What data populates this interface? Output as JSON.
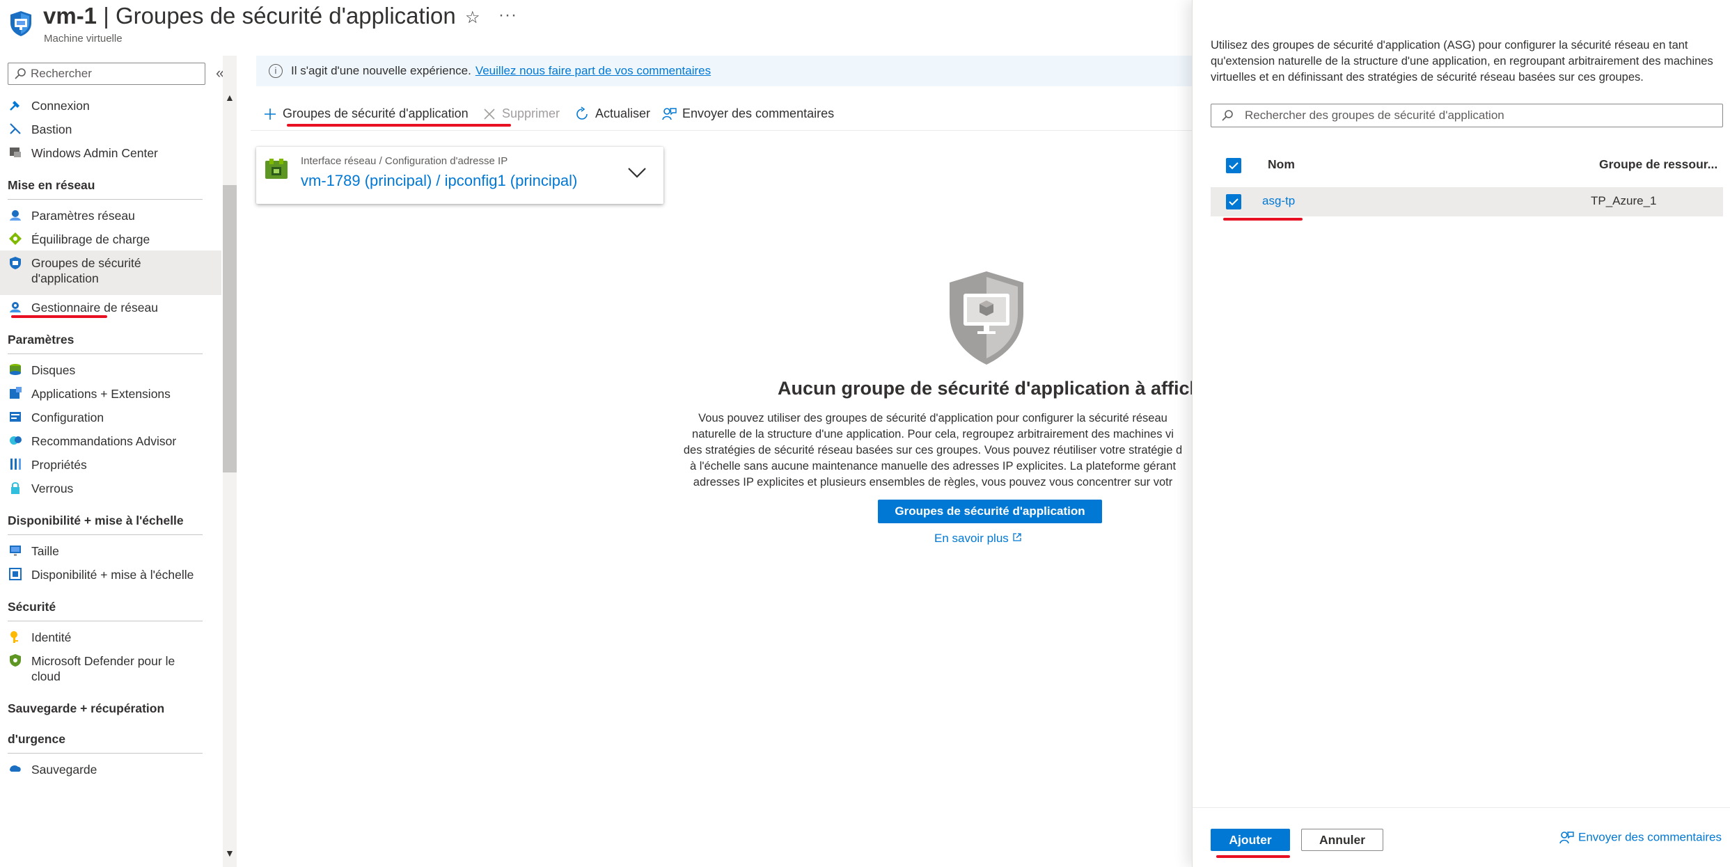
{
  "header": {
    "resource_name": "vm-1",
    "separator": " | ",
    "blade_title": "Groupes de sécurité d'application",
    "subtitle": "Machine virtuelle",
    "favorite_icon": "star-icon",
    "more_icon": "ellipsis-icon"
  },
  "sidebar": {
    "search_placeholder": "Rechercher",
    "collapse_glyph": "«",
    "items": [
      {
        "label": "Connexion",
        "icon": "connect-icon"
      },
      {
        "label": "Bastion",
        "icon": "bastion-icon"
      },
      {
        "label": "Windows Admin Center",
        "icon": "windows-admin-center-icon"
      },
      {
        "section": "Mise en réseau"
      },
      {
        "label": "Paramètres réseau",
        "icon": "network-settings-icon"
      },
      {
        "label": "Équilibrage de charge",
        "icon": "load-balancing-icon"
      },
      {
        "label": "Groupes de sécurité d'application",
        "icon": "asg-shield-icon",
        "selected": true
      },
      {
        "label": "Gestionnaire de réseau",
        "icon": "network-manager-icon"
      },
      {
        "section": "Paramètres"
      },
      {
        "label": "Disques",
        "icon": "disks-icon"
      },
      {
        "label": "Applications + Extensions",
        "icon": "extensions-icon"
      },
      {
        "label": "Configuration",
        "icon": "configuration-icon"
      },
      {
        "label": "Recommandations Advisor",
        "icon": "advisor-icon"
      },
      {
        "label": "Propriétés",
        "icon": "properties-icon"
      },
      {
        "label": "Verrous",
        "icon": "lock-icon"
      },
      {
        "section": "Disponibilité + mise à l'échelle"
      },
      {
        "label": "Taille",
        "icon": "size-icon"
      },
      {
        "label": "Disponibilité + mise à l'échelle",
        "icon": "availability-icon"
      },
      {
        "section": "Sécurité"
      },
      {
        "label": "Identité",
        "icon": "identity-icon"
      },
      {
        "label": "Microsoft Defender pour le cloud",
        "icon": "defender-icon"
      },
      {
        "section": "Sauvegarde + récupération d'urgence"
      },
      {
        "label": "Sauvegarde",
        "icon": "backup-icon"
      }
    ],
    "section_labels": {
      "networking": "Mise en réseau",
      "settings": "Paramètres",
      "availability": "Disponibilité + mise à l'échelle",
      "security": "Sécurité",
      "backup_line1": "Sauvegarde + récupération",
      "backup_line2": "d'urgence"
    }
  },
  "main": {
    "info_bar": {
      "text": "Il s'agit d'une nouvelle expérience.",
      "link": "Veuillez nous faire part de vos commentaires"
    },
    "toolbar": {
      "add_asg": "Groupes de sécurité d'application",
      "delete": "Supprimer",
      "refresh": "Actualiser",
      "feedback": "Envoyer des commentaires"
    },
    "nic_card": {
      "caption": "Interface réseau / Configuration d'adresse IP",
      "value": "vm-1789 (principal) / ipconfig1 (principal)"
    },
    "empty_state": {
      "title": "Aucun groupe de sécurité d'application à affiche",
      "description_lines": [
        "Vous pouvez utiliser des groupes de sécurité d'application pour configurer la sécurité réseau",
        "naturelle de la structure d'une application. Pour cela, regroupez arbitrairement des machines vi",
        "des stratégies de sécurité réseau basées sur ces groupes. Vous pouvez réutiliser votre stratégie d",
        "à l'échelle sans aucune maintenance manuelle des adresses IP explicites. La plateforme gérant",
        "adresses IP explicites et plusieurs ensembles de règles, vous pouvez vous concentrer sur votr"
      ],
      "button": "Groupes de sécurité d'application",
      "learn_more": "En savoir plus"
    }
  },
  "panel": {
    "description": "Utilisez des groupes de sécurité d'application (ASG) pour configurer la sécurité réseau en tant qu'extension naturelle de la structure d'une application, en regroupant arbitrairement des machines virtuelles et en définissant des stratégies de sécurité réseau basées sur ces groupes.",
    "search_placeholder": "Rechercher des groupes de sécurité d'application",
    "columns": {
      "name": "Nom",
      "resource_group": "Groupe de ressour..."
    },
    "rows": [
      {
        "name": "asg-tp",
        "resource_group": "TP_Azure_1",
        "checked": true
      }
    ],
    "select_all_checked": true,
    "add_button": "Ajouter",
    "cancel_button": "Annuler",
    "feedback": "Envoyer des commentaires"
  },
  "colors": {
    "accent": "#0078d4",
    "annotation_red": "#e81123",
    "selected_bg": "#edebe9",
    "info_bg": "#eff6fc"
  }
}
